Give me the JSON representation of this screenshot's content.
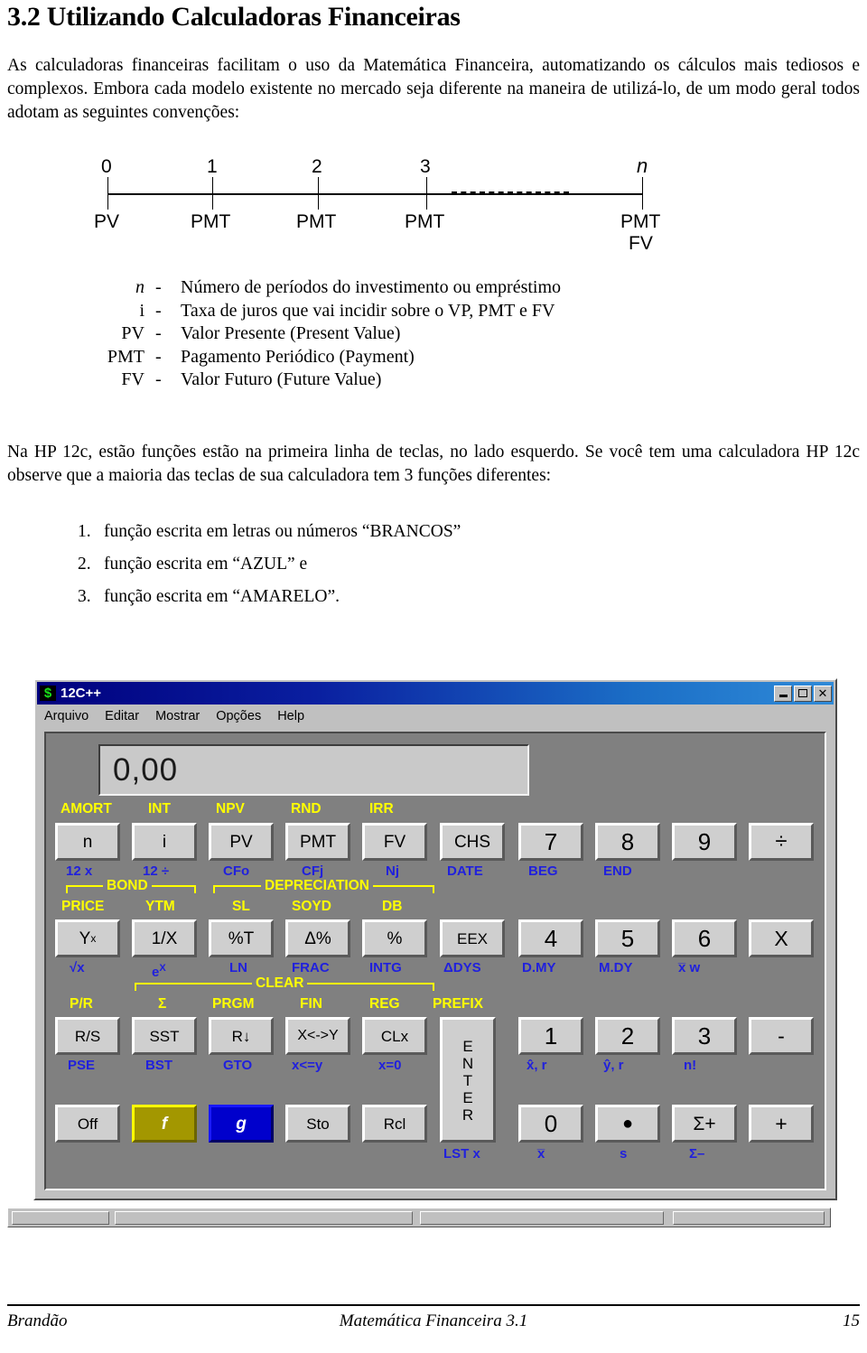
{
  "document": {
    "title": "3.2 Utilizando Calculadoras Financeiras",
    "paragraph1": "As calculadoras financeiras facilitam o uso da Matemática Financeira, automatizando os cálculos mais tediosos e complexos. Embora cada modelo existente no mercado seja diferente na maneira de utilizá-lo, de um modo geral todos adotam as seguintes convenções:",
    "paragraph2": "Na HP 12c, estão funções estão na primeira linha de teclas, no lado esquerdo. Se você tem uma calculadora HP 12c observe que a maioria das teclas de sua calculadora tem 3 funções diferentes:"
  },
  "timeline": {
    "numbers": [
      "0",
      "1",
      "2",
      "3",
      "n"
    ],
    "labels": [
      "PV",
      "PMT",
      "PMT",
      "PMT",
      "PMT"
    ],
    "extra_label": "FV"
  },
  "definitions": [
    {
      "term": "n",
      "dash": "-",
      "desc": "Número de períodos do investimento ou empréstimo"
    },
    {
      "term": "i",
      "dash": "-",
      "desc": "Taxa de juros que vai incidir sobre o VP, PMT e FV"
    },
    {
      "term": "PV",
      "dash": "-",
      "desc": "Valor Presente (Present Value)"
    },
    {
      "term": "PMT",
      "dash": "-",
      "desc": "Pagamento Periódico (Payment)"
    },
    {
      "term": "FV",
      "dash": "-",
      "desc": "Valor Futuro (Future Value)"
    }
  ],
  "numbered_list": [
    {
      "num": "1.",
      "text": "função escrita em letras ou números “BRANCOS”"
    },
    {
      "num": "2.",
      "text": "função escrita em “AZUL” e"
    },
    {
      "num": "3.",
      "text": "função escrita em “AMARELO”."
    }
  ],
  "calculator": {
    "window_title": "12C++",
    "icon_glyph": "$",
    "titlebar_buttons": {
      "minimize": "minimize-icon",
      "maximize": "maximize-icon",
      "close": "✕"
    },
    "menu": [
      "Arquivo",
      "Editar",
      "Mostrar",
      "Opções",
      "Help"
    ],
    "display_value": "0,00",
    "colors": {
      "yellow_function": "#ffff00",
      "blue_function": "#2020dd",
      "f_key_bg": "#a39700",
      "g_key_bg": "#0000cc",
      "body_bg": "#808080",
      "key_face": "#cfcfcf",
      "titlebar": "#00007e"
    },
    "row1": {
      "yellow": [
        "AMORT",
        "INT",
        "NPV",
        "RND",
        "IRR"
      ],
      "keys": [
        "n",
        "i",
        "PV",
        "PMT",
        "FV",
        "CHS",
        "7",
        "8",
        "9",
        "÷"
      ],
      "blue": [
        "12 x",
        "12 ÷",
        "CFo",
        "CFj",
        "Nj",
        "DATE",
        "BEG",
        "END"
      ]
    },
    "row2": {
      "brackets": [
        "BOND",
        "DEPRECIATION"
      ],
      "yellow": [
        "PRICE",
        "YTM",
        "SL",
        "SOYD",
        "DB"
      ],
      "keys": [
        "Y",
        "1/X",
        "%T",
        "Δ%",
        "%",
        "EEX",
        "4",
        "5",
        "6",
        "X"
      ],
      "key1_sup": "x",
      "blue": [
        "√x",
        "e",
        "LN",
        "FRAC",
        "INTG",
        "ΔDYS",
        "D.MY",
        "M.DY",
        "x̅ w"
      ],
      "blue2_sup": "X"
    },
    "row3": {
      "bracket": "CLEAR",
      "yellow": [
        "P/R",
        "Σ",
        "PRGM",
        "FIN",
        "REG",
        "PREFIX"
      ],
      "keys": [
        "R/S",
        "SST",
        "R↓",
        "X<->Y",
        "CLx",
        "ENTER",
        "1",
        "2",
        "3",
        "-"
      ],
      "blue": [
        "PSE",
        "BST",
        "GTO",
        "x<=y",
        "x=0",
        "x̂, r",
        "ŷ, r",
        "n!"
      ]
    },
    "row4": {
      "keys": [
        "Off",
        "f",
        "g",
        "Sto",
        "Rcl",
        "0",
        "●",
        "Σ+",
        "+"
      ],
      "blue": [
        "LST x",
        "x̅",
        "s",
        "Σ–"
      ]
    }
  },
  "footer": {
    "left": "Brandão",
    "center": "Matemática Financeira 3.1",
    "right": "15"
  }
}
